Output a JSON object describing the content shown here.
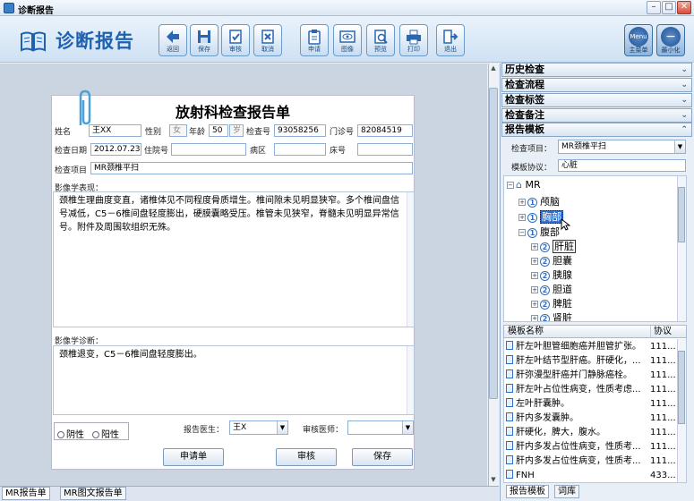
{
  "window": {
    "title": "诊断报告",
    "min": "–",
    "max": "□",
    "close": "✕"
  },
  "header": {
    "title": "诊断报告",
    "toolbar": [
      {
        "name": "back",
        "label": "返回"
      },
      {
        "name": "save",
        "label": "保存"
      },
      {
        "name": "audit",
        "label": "审核"
      },
      {
        "name": "cancel",
        "label": "取消"
      },
      {
        "name": "request",
        "label": "申请"
      },
      {
        "name": "image",
        "label": "图像"
      },
      {
        "name": "preview",
        "label": "预览"
      },
      {
        "name": "print",
        "label": "打印"
      },
      {
        "name": "exit",
        "label": "退出"
      }
    ],
    "menu_label": "主菜单",
    "menu_badge": "Menu",
    "minimize_label": "最小化"
  },
  "report": {
    "title": "放射科检查报告单",
    "name_label": "姓名",
    "name": "王XX",
    "gender_label": "性别",
    "gender": "女",
    "age_label": "年龄",
    "age": "50",
    "age_unit": "岁",
    "exam_no_label": "检查号",
    "exam_no": "93058256",
    "outpatient_label": "门诊号",
    "outpatient_no": "82084519",
    "exam_date_label": "检查日期",
    "exam_date": "2012.07.23",
    "inpatient_label": "住院号",
    "inpatient_no": "",
    "ward_label": "病区",
    "ward": "",
    "bed_label": "床号",
    "bed": "",
    "exam_item_label": "检查项目",
    "exam_item": "MR颈椎平扫",
    "findings_label": "影像学表现：",
    "findings": "颈椎生理曲度变直，诸椎体见不同程度骨质增生。椎间隙未见明显狭窄。多个椎间盘信号减低，C5－6椎间盘轻度膨出，硬膜囊略受压。椎管未见狭窄，脊髓未见明显异常信号。附件及周围软组织无殊。",
    "diagnosis_label": "影像学诊断：",
    "diagnosis": "颈椎退变，C5－6椎间盘轻度膨出。",
    "negative_label": "阴性",
    "positive_label": "阳性",
    "report_doctor_label": "报告医生：",
    "report_doctor": "王X",
    "audit_doctor_label": "审核医师：",
    "audit_doctor": "",
    "btn_request": "申请单",
    "btn_audit": "审核",
    "btn_save": "保存"
  },
  "bottom_tabs": [
    "MR报告单",
    "MR图文报告单"
  ],
  "right": {
    "sections": [
      "历史检查",
      "检查流程",
      "检查标签",
      "检查备注"
    ],
    "template_title": "报告模板",
    "exam_item_label": "检查项目：",
    "exam_item": "MR颈椎平扫",
    "protocol_label": "模板协议：",
    "protocol": "心脏",
    "tree": {
      "root": "MR",
      "nodes": [
        {
          "num": "1",
          "label": "颅脑"
        },
        {
          "num": "1",
          "label": "胸部"
        },
        {
          "num": "1",
          "label": "腹部"
        }
      ],
      "children": [
        {
          "num": "2",
          "label": "肝脏"
        },
        {
          "num": "2",
          "label": "胆囊"
        },
        {
          "num": "2",
          "label": "胰腺"
        },
        {
          "num": "2",
          "label": "胆道"
        },
        {
          "num": "2",
          "label": "脾脏"
        },
        {
          "num": "2",
          "label": "肾脏"
        }
      ]
    },
    "list_headers": [
      "模板名称",
      "协议"
    ],
    "list": [
      {
        "name": "肝左叶胆管细胞癌并胆管扩张。",
        "proto": "111..."
      },
      {
        "name": "肝左叶结节型肝癌。肝硬化，...",
        "proto": "111..."
      },
      {
        "name": "肝弥漫型肝癌并门静脉癌栓。",
        "proto": "111..."
      },
      {
        "name": "肝左叶占位性病变，性质考虑...",
        "proto": "111..."
      },
      {
        "name": "左叶肝囊肿。",
        "proto": "111..."
      },
      {
        "name": "肝内多发囊肿。",
        "proto": "111..."
      },
      {
        "name": "肝硬化，脾大，腹水。",
        "proto": "111..."
      },
      {
        "name": "肝内多发占位性病变，性质考...",
        "proto": "111..."
      },
      {
        "name": "肝内多发占位性病变，性质考...",
        "proto": "111..."
      },
      {
        "name": "FNH",
        "proto": "433..."
      }
    ],
    "tabs": [
      "报告模板",
      "词库"
    ]
  }
}
